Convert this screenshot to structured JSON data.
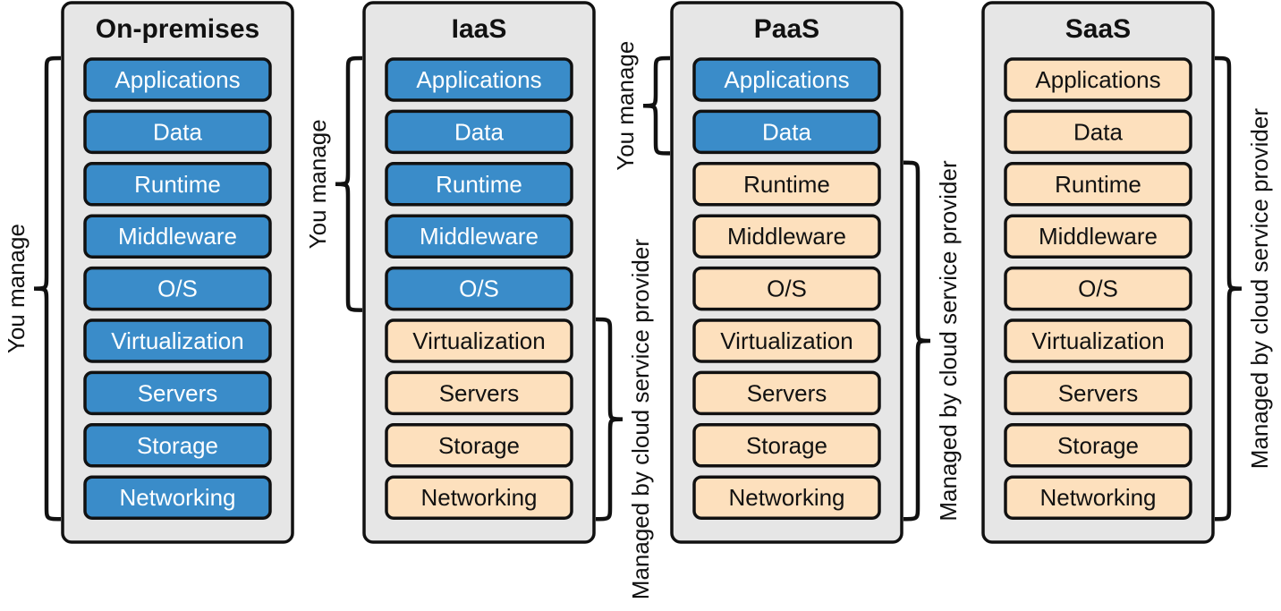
{
  "colors": {
    "you_manage": "#3a8cc9",
    "provider_manages": "#fde0bd",
    "panel": "#e6e6e6",
    "outline": "#111111"
  },
  "layers": [
    "Applications",
    "Data",
    "Runtime",
    "Middleware",
    "O/S",
    "Virtualization",
    "Servers",
    "Storage",
    "Networking"
  ],
  "columns": [
    {
      "title": "On-premises",
      "you_manage_count": 9,
      "braces": [
        {
          "side": "left",
          "label": "You manage",
          "from": 0,
          "to": 8
        }
      ]
    },
    {
      "title": "IaaS",
      "you_manage_count": 5,
      "braces": [
        {
          "side": "left",
          "label": "You manage",
          "from": 0,
          "to": 4
        },
        {
          "side": "right",
          "label": "Managed by cloud service provider",
          "from": 5,
          "to": 8
        }
      ]
    },
    {
      "title": "PaaS",
      "you_manage_count": 2,
      "braces": [
        {
          "side": "left",
          "label": "You manage",
          "from": 0,
          "to": 1
        },
        {
          "side": "right",
          "label": "Managed by cloud service provider",
          "from": 2,
          "to": 8
        }
      ]
    },
    {
      "title": "SaaS",
      "you_manage_count": 0,
      "braces": [
        {
          "side": "right",
          "label": "Managed by cloud service provider",
          "from": 0,
          "to": 8
        }
      ]
    }
  ]
}
